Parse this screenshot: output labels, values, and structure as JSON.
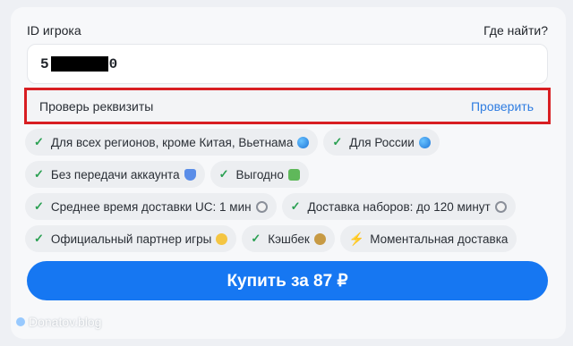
{
  "player_id": {
    "label": "ID игрока",
    "find_link": "Где найти?",
    "value_prefix": "5",
    "value_suffix": "0"
  },
  "verify": {
    "text": "Проверь реквизиты",
    "link": "Проверить"
  },
  "features": [
    [
      {
        "text": "Для всех регионов, кроме Китая, Вьетнама",
        "icon": "globe-icon"
      },
      {
        "text": "Для России",
        "icon": "globe-icon"
      }
    ],
    [
      {
        "text": "Без передачи аккаунта",
        "icon": "shield-icon"
      },
      {
        "text": "Выгодно",
        "icon": "money-icon"
      }
    ],
    [
      {
        "text": "Среднее время доставки UC: 1 мин",
        "icon": "clock-icon"
      },
      {
        "text": "Доставка наборов: до 120 минут",
        "icon": "clock-icon"
      }
    ],
    [
      {
        "text": "Официальный партнер игры",
        "icon": "handshake-icon"
      },
      {
        "text": "Кэшбек",
        "icon": "money-bag-icon"
      },
      {
        "text": "Моментальная доставка",
        "icon": "lightning-icon"
      }
    ]
  ],
  "buy_button": "Купить за 87 ₽",
  "watermark": "Donatov.blog",
  "colors": {
    "accent": "#1677f2",
    "highlight_border": "#d81e22",
    "check": "#2aa052",
    "link": "#2f7de1"
  }
}
